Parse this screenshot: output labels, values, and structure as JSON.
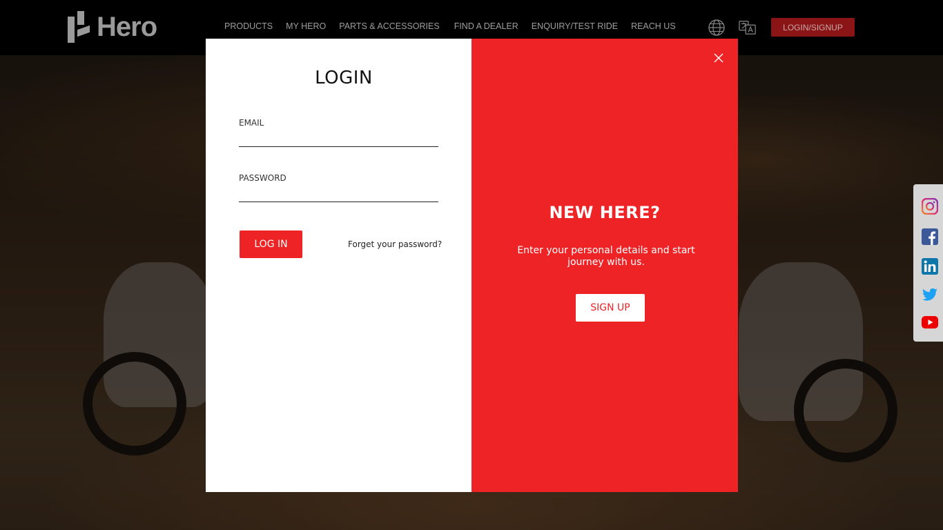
{
  "header": {
    "logo_text": "Hero",
    "nav": [
      "PRODUCTS",
      "MY HERO",
      "PARTS & ACCESSORIES",
      "FIND A DEALER",
      "ENQUIRY/TEST RIDE",
      "REACH US"
    ],
    "login_signup": "LOGIN/SIGNUP",
    "icons": [
      "globe-icon",
      "translate-icon"
    ]
  },
  "login": {
    "title": "LOGIN",
    "email_label": "EMAIL",
    "email_value": "",
    "password_label": "PASSWORD",
    "password_value": "",
    "submit_label": "LOG IN",
    "forgot_label": "Forget your password?"
  },
  "signup_panel": {
    "title": "NEW HERE?",
    "description": "Enter your personal details and start journey with us.",
    "button_label": "SIGN UP"
  },
  "social": [
    "instagram-icon",
    "facebook-icon",
    "linkedin-icon",
    "twitter-icon",
    "youtube-icon"
  ],
  "colors": {
    "brand_red": "#ee2326",
    "header_bg": "#000000",
    "login_btn_bg": "#8b1417"
  }
}
